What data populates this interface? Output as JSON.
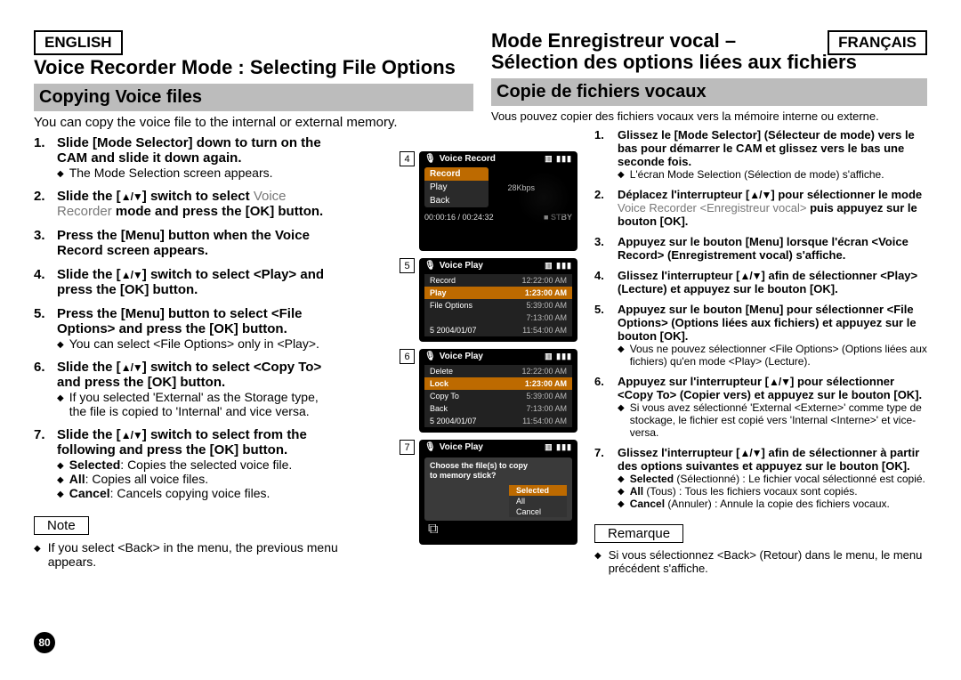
{
  "lang": {
    "en": "ENGLISH",
    "fr": "FRANÇAIS"
  },
  "left": {
    "title": "Voice Recorder Mode : Selecting File Options",
    "bar": "Copying Voice files",
    "intro": "You can copy the voice file to the internal or external memory.",
    "s1": "Slide [Mode Selector] down to turn on the CAM and slide it down again.",
    "s1sub": "The Mode Selection screen appears.",
    "s2a": "Slide the [",
    "s2arrow": "▲/▼",
    "s2b": "] switch to select ",
    "s2mode": "Voice Recorder",
    "s2c": " mode and press the [OK] button.",
    "s3": "Press the [Menu] button when the Voice Record screen appears.",
    "s4a": "Slide the [",
    "s4b": "] switch to select <Play> and press the [OK] button.",
    "s5": "Press the [Menu] button to select <File Options> and press the [OK] button.",
    "s5sub": "You can select <File Options> only in <Play>.",
    "s6a": "Slide the [",
    "s6b": "] switch to select <Copy To> and press the [OK] button.",
    "s6sub": "If you selected 'External' as the Storage type, the file is copied to 'Internal' and vice versa.",
    "s7a": "Slide the [",
    "s7b": "] switch to select from the following and press the [OK] button.",
    "s7o1a": "Selected",
    "s7o1b": ": Copies the selected voice file.",
    "s7o2a": "All",
    "s7o2b": ": Copies all voice files.",
    "s7o3a": "Cancel",
    "s7o3b": ": Cancels copying voice files.",
    "note": "Note",
    "noteText": "If you select <Back> in the menu, the previous menu appears.",
    "pageNum": "80"
  },
  "right": {
    "title1": "Mode Enregistreur vocal –",
    "title2": "Sélection des options liées aux fichiers",
    "bar": "Copie de fichiers vocaux",
    "intro": "Vous pouvez copier des fichiers vocaux vers la mémoire interne ou externe.",
    "s1": "Glissez le [Mode Selector] (Sélecteur de mode) vers le bas pour démarrer le CAM et glissez vers le bas une seconde fois.",
    "s1sub": "L'écran Mode Selection (Sélection de mode) s'affiche.",
    "s2a": "Déplacez l'interrupteur [",
    "s2b": "] pour sélectionner le mode ",
    "s2mode": "Voice Recorder <Enregistreur vocal>",
    "s2c": " puis appuyez sur le bouton [OK].",
    "s3": "Appuyez sur le bouton [Menu] lorsque l'écran <Voice Record> (Enregistrement vocal) s'affiche.",
    "s4a": "Glissez l'interrupteur [",
    "s4b": "] afin de sélectionner <Play> (Lecture) et appuyez sur le bouton [OK].",
    "s5": "Appuyez sur le bouton [Menu] pour sélectionner <File Options> (Options liées aux fichiers) et appuyez sur le bouton [OK].",
    "s5sub": "Vous ne pouvez sélectionner <File Options> (Options liées aux fichiers) qu'en mode <Play> (Lecture).",
    "s6a": "Appuyez sur l'interrupteur [",
    "s6b": "] pour sélectionner <Copy To> (Copier vers) et appuyez sur le bouton [OK].",
    "s6sub": "Si vous avez sélectionné 'External <Externe>' comme type de stockage, le fichier est copié vers 'Internal <Interne>' et vice-versa.",
    "s7a": "Glissez l'interrupteur [",
    "s7b": "] afin de sélectionner à partir des options suivantes et appuyez sur le bouton [OK].",
    "s7o1a": "Selected",
    "s7o1b": " (Sélectionné) : Le fichier vocal sélectionné est copié.",
    "s7o2a": "All",
    "s7o2b": " (Tous) : Tous les fichiers vocaux sont copiés.",
    "s7o3a": "Cancel",
    "s7o3b": " (Annuler) : Annule la copie des fichiers vocaux.",
    "note": "Remarque",
    "noteText": "Si vous sélectionnez <Back> (Retour) dans le menu, le menu précédent s'affiche."
  },
  "scr": {
    "n4": "4",
    "n5": "5",
    "n6": "6",
    "n7": "7",
    "hdrRec": "Voice Record",
    "hdrPlay": "Voice Play",
    "batt": "▥ ▮▮▮",
    "rec": "Record",
    "play": "Play",
    "back": "Back",
    "fileOptions": "File Options",
    "kbps": "28Kbps",
    "time": "00:00:16 / 00:24:32",
    "stby": "STBY",
    "delete": "Delete",
    "lock": "Lock",
    "copyTo": "Copy To",
    "t1": "12:22:00 AM",
    "t2": "1:23:00 AM",
    "t3": "5:39:00 AM",
    "t4": "7:13:00 AM",
    "t5": "11:54:00 AM",
    "date5": "5  2004/01/07",
    "dlgQ": "ose the file(s) to copy to memory stick?",
    "dlgQfull1": "Choose the file(s) to copy",
    "dlgQfull2": "to memory stick?",
    "optSel": "Selected",
    "optAll": "All",
    "optCancel": "Cancel"
  }
}
